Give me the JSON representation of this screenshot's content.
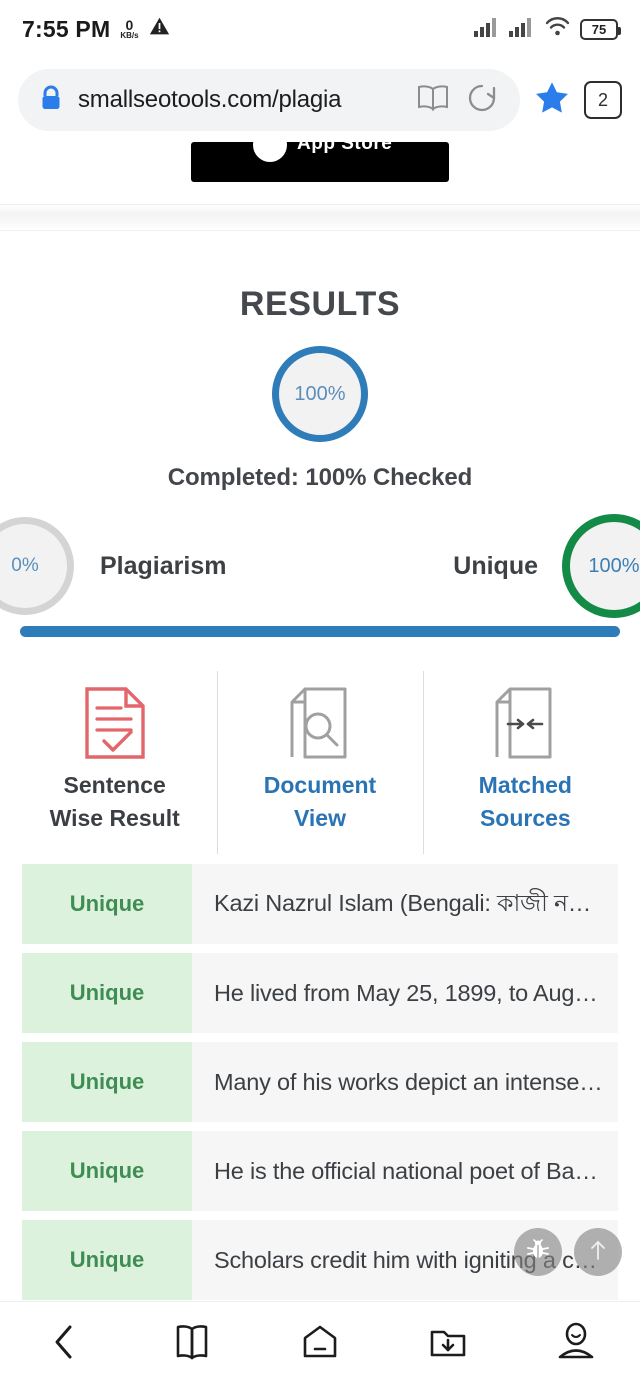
{
  "status_bar": {
    "clock": "7:55 PM",
    "net_speed_value": "0",
    "net_speed_unit": "KB/s",
    "warning_icon": "warning-triangle-icon",
    "signal_icon_1": "signal-bars-icon",
    "signal_icon_2": "signal-bars-icon",
    "wifi_icon": "wifi-icon",
    "battery_level": "75"
  },
  "browser": {
    "lock_icon": "lock-icon",
    "url": "smallseotools.com/plagia",
    "reader_icon": "book-reader-icon",
    "reload_icon": "reload-icon",
    "bookmark_icon": "star-bookmark-icon",
    "tab_count": "2"
  },
  "ad": {
    "label": "App Store",
    "icon": "apple-logo-icon"
  },
  "results": {
    "title": "RESULTS",
    "overall_percent": "100%",
    "completed_text": "Completed: 100% Checked",
    "plagiarism_percent": "0%",
    "plagiarism_label": "Plagiarism",
    "unique_label": "Unique",
    "unique_percent": "100%",
    "progress_fill_percent": 100,
    "colors": {
      "blue": "#2e7cb8",
      "green": "#138a46",
      "gray_ring": "#d4d4d4",
      "link_blue": "#2a74b5",
      "tag_green_bg": "#ddf2dc",
      "tag_green_text": "#3f8d55",
      "red_icon": "#e2666a"
    }
  },
  "tabs": [
    {
      "label_line1": "Sentence",
      "label_line2": "Wise Result",
      "icon": "document-check-icon",
      "active": true
    },
    {
      "label_line1": "Document",
      "label_line2": "View",
      "icon": "document-search-icon",
      "active": false
    },
    {
      "label_line1": "Matched",
      "label_line2": "Sources",
      "icon": "document-match-icon",
      "active": false
    }
  ],
  "sentences": [
    {
      "tag": "Unique",
      "text": "Kazi Nazrul Islam (Bengali: কাজী ন…"
    },
    {
      "tag": "Unique",
      "text": "He lived from May 25, 1899, to Aug…"
    },
    {
      "tag": "Unique",
      "text": "Many of his works depict an intense…"
    },
    {
      "tag": "Unique",
      "text": "He is the official national poet of Ba…"
    },
    {
      "tag": "Unique",
      "text": "Scholars credit him with igniting a c…"
    }
  ],
  "fabs": [
    {
      "icon": "bug-report-icon"
    },
    {
      "icon": "scroll-to-top-arrow-icon"
    }
  ],
  "bottom_nav": [
    {
      "icon": "back-chevron-icon"
    },
    {
      "icon": "bookmarks-book-icon"
    },
    {
      "icon": "home-icon"
    },
    {
      "icon": "downloads-folder-icon"
    },
    {
      "icon": "profile-person-icon"
    }
  ]
}
